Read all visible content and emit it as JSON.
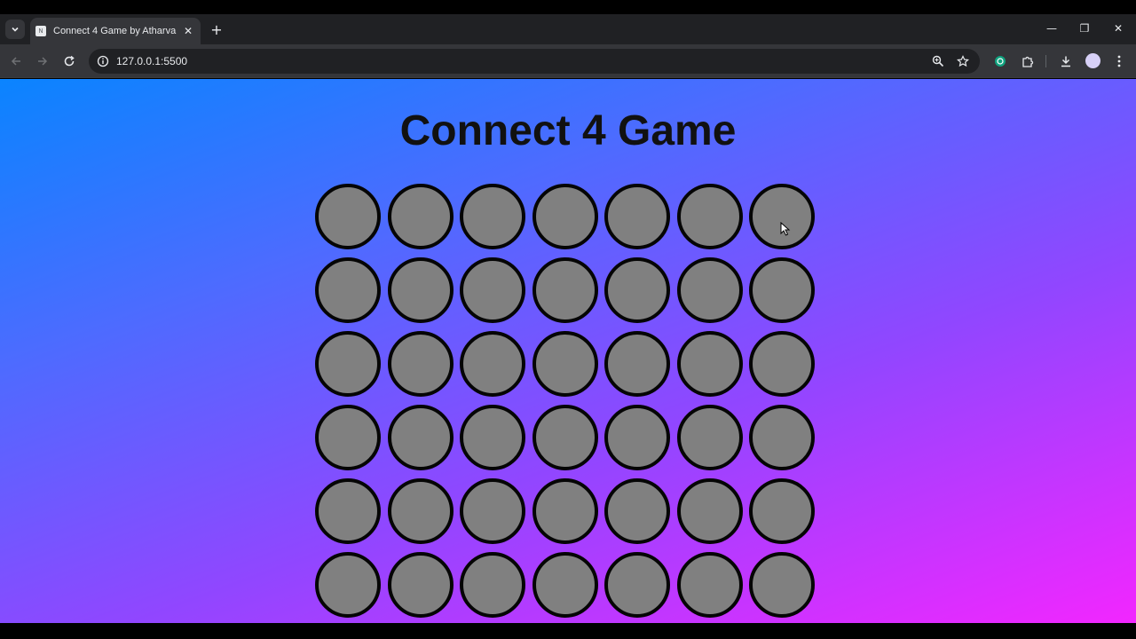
{
  "browser": {
    "tab": {
      "title": "Connect 4 Game by Atharva",
      "favicon_text": "N"
    },
    "new_tab_glyph": "+",
    "close_glyph": "✕",
    "window_controls": {
      "minimize": "—",
      "restore": "❐",
      "close": "✕"
    },
    "address_bar": {
      "url": "127.0.0.1:5500"
    },
    "icons": {
      "tab_search": "chevron-down-icon",
      "back": "arrow-left-icon",
      "forward": "arrow-right-icon",
      "reload": "reload-icon",
      "site_info": "info-icon",
      "zoom": "zoom-icon",
      "bookmark": "star-icon",
      "extension": "extension-icon",
      "puzzle": "puzzle-icon",
      "download": "download-icon",
      "profile": "avatar",
      "menu": "kebab-menu-icon"
    },
    "colors": {
      "tabbar": "#202124",
      "toolbar": "#35363a"
    }
  },
  "page": {
    "title": "Connect 4 Game",
    "colors": {
      "gradient_start": "#0a84ff",
      "gradient_end": "#f226ff",
      "empty_cell": "#808080",
      "cell_border": "#050505"
    },
    "board": {
      "rows": 6,
      "columns": 7
    }
  }
}
